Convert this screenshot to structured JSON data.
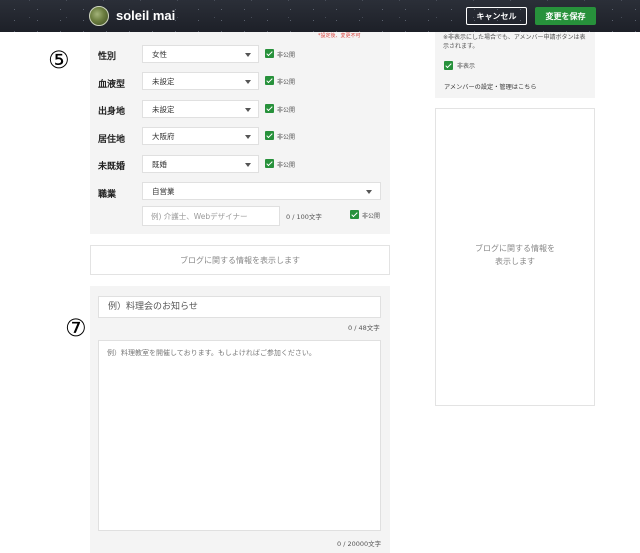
{
  "header": {
    "username": "soleil mai",
    "cancel_label": "キャンセル",
    "save_label": "変更を保存"
  },
  "profile": {
    "note": "*設定後、変更不可",
    "section_marker": "⑤",
    "private_label": "非公開",
    "rows": [
      {
        "label": "性別",
        "value": "女性"
      },
      {
        "label": "血液型",
        "value": "未設定"
      },
      {
        "label": "出身地",
        "value": "未設定"
      },
      {
        "label": "居住地",
        "value": "大阪府"
      },
      {
        "label": "未既婚",
        "value": "既婚"
      }
    ],
    "occupation": {
      "label": "職業",
      "value": "自営業",
      "placeholder": "例) 介護士、Webデザイナー",
      "count": "0 / 100文字"
    }
  },
  "blog_info": "ブログに関する情報を表示します",
  "post": {
    "section_marker": "⑦",
    "title_placeholder": "例）料理会のお知らせ",
    "title_count": "0 / 48文字",
    "body_placeholder": "例）料理教室を開催しております。もしよければご参加ください。",
    "body_count": "0 / 20000文字"
  },
  "sidebar": {
    "note": "※非表示にした場合でも、アメンバー申請ボタンは表示されます。",
    "hidden_label": "非表示",
    "amember_link": "アメンバーの設定・管理はこちら",
    "blog_info_line1": "ブログに関する情報を",
    "blog_info_line2": "表示します"
  },
  "colors": {
    "accent_green": "#27913b",
    "note_red": "#d9423c",
    "header_dark": "#23262e"
  }
}
